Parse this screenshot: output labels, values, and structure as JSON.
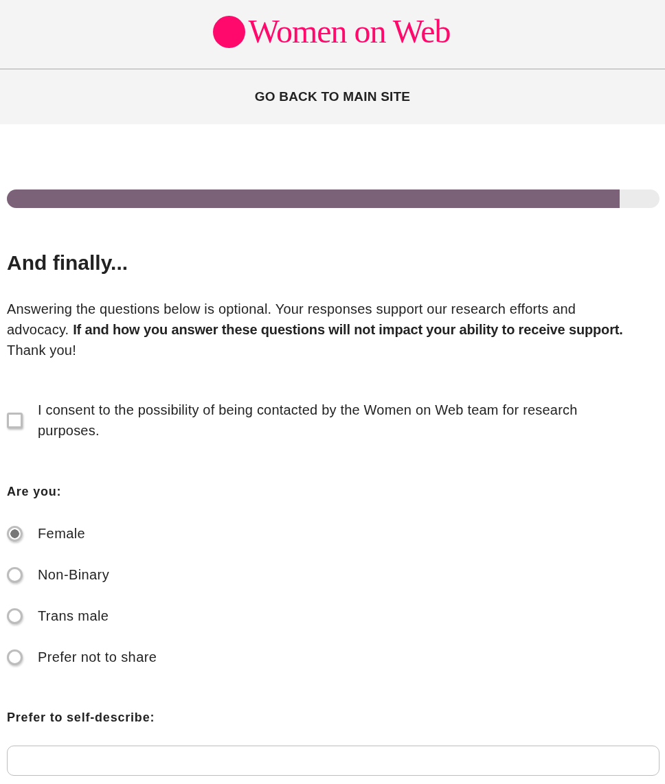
{
  "header": {
    "logo": "Women on Web"
  },
  "nav": {
    "link": "GO BACK TO MAIN SITE"
  },
  "progress": {
    "level": 0.939
  },
  "form": {
    "title": "And finally...",
    "intro": "Answering the questions below is optional. Your responses support our research efforts and advocacy. **If and how you answer these questions will not impact your ability to receive support.** Thank you!",
    "consent": {
      "label": "I consent to the possibility of being contacted by the Women on Web team for research purposes.",
      "checked": false
    },
    "gender": {
      "label": "Are you:",
      "options": [
        {
          "label": "Female",
          "selected": true
        },
        {
          "label": "Non-Binary",
          "selected": false
        },
        {
          "label": "Trans male",
          "selected": false
        },
        {
          "label": "Prefer not to share",
          "selected": false
        }
      ]
    },
    "self_describe": {
      "label": "Prefer to self-describe:"
    }
  }
}
